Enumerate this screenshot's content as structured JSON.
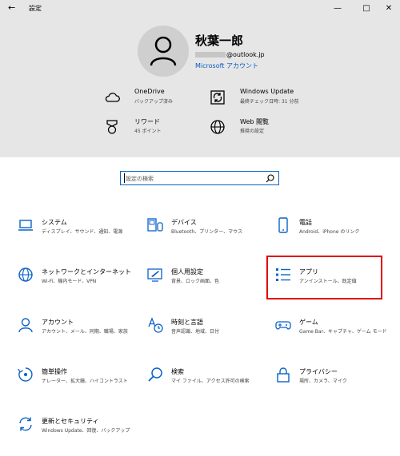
{
  "window": {
    "back_glyph": "←",
    "title": "設定",
    "minimize_glyph": "—",
    "maximize_glyph": "□",
    "close_glyph": "✕"
  },
  "profile": {
    "name": "秋葉一郎",
    "email_suffix": "@outlook.jp",
    "account_link": "Microsoft アカウント"
  },
  "header_items": [
    {
      "title": "OneDrive",
      "subtitle": "バックアップ済み",
      "icon": "cloud-icon"
    },
    {
      "title": "Windows Update",
      "subtitle": "最終チェック日時: 31 分前",
      "icon": "update-icon"
    },
    {
      "title": "リワード",
      "subtitle": "45 ポイント",
      "icon": "medal-icon"
    },
    {
      "title": "Web 閲覧",
      "subtitle": "推奨の設定",
      "icon": "globe-icon"
    }
  ],
  "search": {
    "placeholder": "設定の検索"
  },
  "tiles": [
    {
      "title": "システム",
      "subtitle": "ディスプレイ、サウンド、通知、電源",
      "icon": "laptop-icon"
    },
    {
      "title": "デバイス",
      "subtitle": "Bluetooth、プリンター、マウス",
      "icon": "devices-icon"
    },
    {
      "title": "電話",
      "subtitle": "Android、iPhone のリンク",
      "icon": "phone-icon"
    },
    {
      "title": "ネットワークとインターネット",
      "subtitle": "Wi-Fi、機内モード、VPN",
      "icon": "network-globe-icon"
    },
    {
      "title": "個人用設定",
      "subtitle": "背景、ロック画面、色",
      "icon": "personalization-icon"
    },
    {
      "title": "アプリ",
      "subtitle": "アンインストール、既定値",
      "icon": "apps-list-icon"
    },
    {
      "title": "アカウント",
      "subtitle": "アカウント、メール、同期、職場、家族",
      "icon": "person-icon"
    },
    {
      "title": "時刻と言語",
      "subtitle": "音声認識、地域、日付",
      "icon": "time-language-icon"
    },
    {
      "title": "ゲーム",
      "subtitle": "Game Bar、キャプチャ、ゲーム モード",
      "icon": "gamepad-icon"
    },
    {
      "title": "簡単操作",
      "subtitle": "ナレーター、拡大鏡、ハイコントラスト",
      "icon": "ease-of-access-icon"
    },
    {
      "title": "検索",
      "subtitle": "マイ ファイル、アクセス許可の検索",
      "icon": "search-icon"
    },
    {
      "title": "プライバシー",
      "subtitle": "場所、カメラ、マイク",
      "icon": "lock-icon"
    },
    {
      "title": "更新とセキュリティ",
      "subtitle": "Windows Update、回復、バックアップ",
      "icon": "sync-icon"
    }
  ],
  "colors": {
    "accent": "#0a62c9",
    "highlight": "#e00000",
    "header_bg": "#e6e6e6"
  }
}
